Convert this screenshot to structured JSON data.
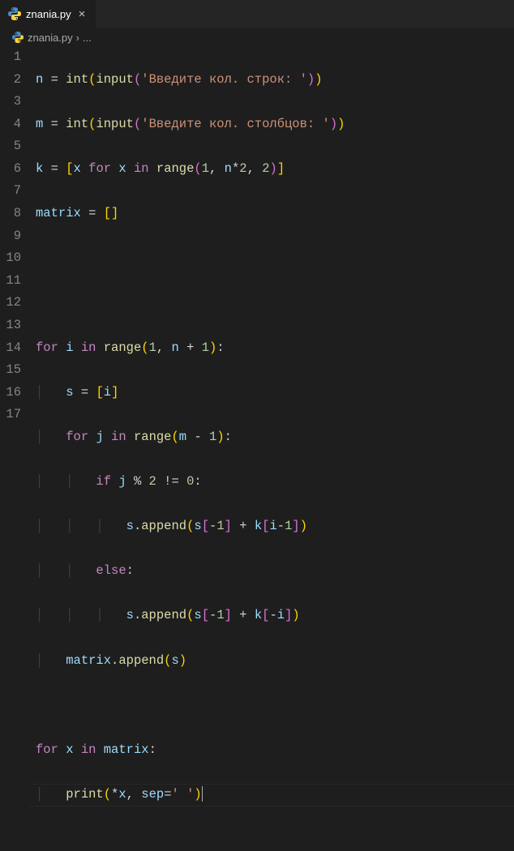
{
  "tab": {
    "filename": "znania.py",
    "close_glyph": "×"
  },
  "breadcrumb": {
    "filename": "znania.py",
    "chevron": "›",
    "ellipsis": "..."
  },
  "icons": {
    "python_label": "python-file-icon"
  },
  "line_numbers": [
    "1",
    "2",
    "3",
    "4",
    "5",
    "6",
    "7",
    "8",
    "9",
    "10",
    "11",
    "12",
    "13",
    "14",
    "15",
    "16",
    "17"
  ],
  "code": {
    "l1": {
      "a": "n",
      "b": " = ",
      "c": "int",
      "d": "input",
      "e": "'Введите кол. строк: '"
    },
    "l2": {
      "a": "m",
      "b": " = ",
      "c": "int",
      "d": "input",
      "e": "'Введите кол. столбцов: '"
    },
    "l3": {
      "a": "k",
      "b": " = ",
      "lb": "[",
      "x1": "x",
      "kw1": " for ",
      "x2": "x",
      "kw2": " in ",
      "fn": "range",
      "lp": "(",
      "n1": "1",
      "c1": ", ",
      "v": "n",
      "op": "*",
      "n2": "2",
      "c2": ", ",
      "n3": "2",
      "rp": ")",
      "rb": "]"
    },
    "l4": {
      "a": "matrix",
      "b": " = ",
      "lb": "[",
      "rb": "]"
    },
    "l7": {
      "kw": "for ",
      "v": "i",
      "kw2": " in ",
      "fn": "range",
      "lp": "(",
      "n1": "1",
      "c1": ", ",
      "v2": "n",
      "op": " + ",
      "n2": "1",
      "rp": ")",
      "col": ":"
    },
    "l8": {
      "a": "s",
      "b": " = ",
      "lb": "[",
      "v": "i",
      "rb": "]"
    },
    "l9": {
      "kw": "for ",
      "v": "j",
      "kw2": " in ",
      "fn": "range",
      "lp": "(",
      "v2": "m",
      "op": " - ",
      "n": "1",
      "rp": ")",
      "col": ":"
    },
    "l10": {
      "kw": "if ",
      "v": "j",
      "op": " % ",
      "n1": "2",
      "op2": " != ",
      "n2": "0",
      "col": ":"
    },
    "l11": {
      "v": "s",
      "d": ".",
      "fn": "append",
      "lp": "(",
      "v2": "s",
      "lb": "[",
      "op": "-",
      "n": "1",
      "rb": "]",
      "op2": " + ",
      "v3": "k",
      "lb2": "[",
      "v4": "i",
      "op3": "-",
      "n2": "1",
      "rb2": "]",
      "rp": ")"
    },
    "l12": {
      "kw": "else",
      "col": ":"
    },
    "l13": {
      "v": "s",
      "d": ".",
      "fn": "append",
      "lp": "(",
      "v2": "s",
      "lb": "[",
      "op": "-",
      "n": "1",
      "rb": "]",
      "op2": " + ",
      "v3": "k",
      "lb2": "[",
      "op3": "-",
      "v4": "i",
      "rb2": "]",
      "rp": ")"
    },
    "l14": {
      "v": "matrix",
      "d": ".",
      "fn": "append",
      "lp": "(",
      "v2": "s",
      "rp": ")"
    },
    "l16": {
      "kw": "for ",
      "v": "x",
      "kw2": " in ",
      "v2": "matrix",
      "col": ":"
    },
    "l17": {
      "fn": "print",
      "lp": "(",
      "op": "*",
      "v": "x",
      "c": ", ",
      "p": "sep",
      "eq": "=",
      "s": "' '",
      "rp": ")"
    }
  }
}
